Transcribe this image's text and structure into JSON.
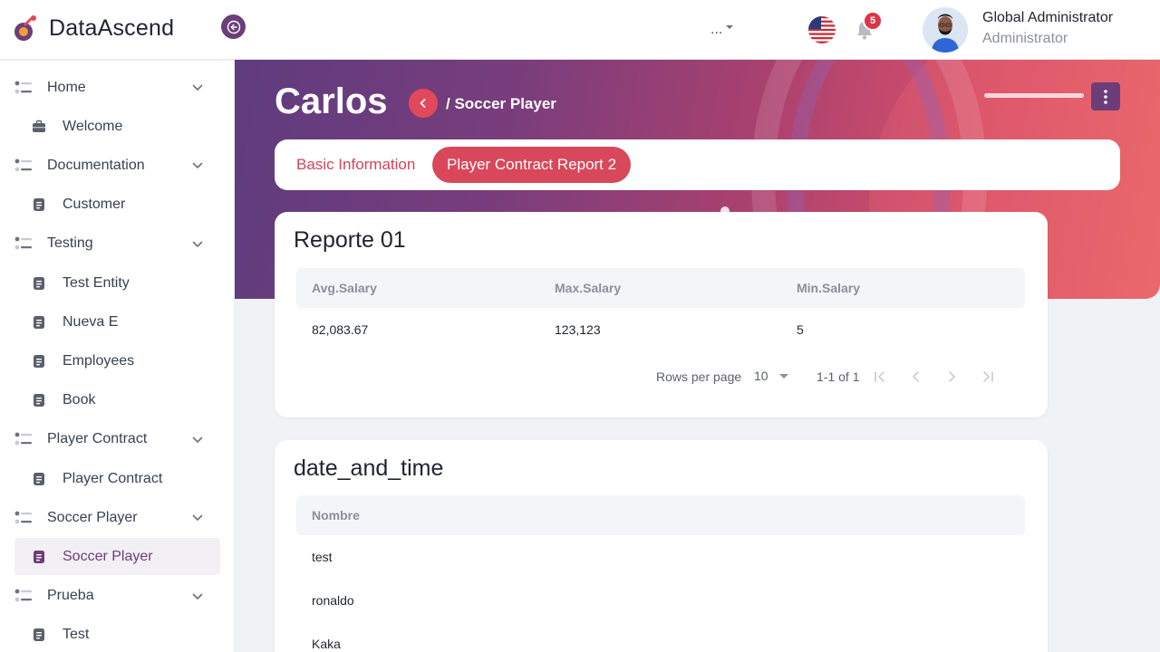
{
  "app": {
    "brand": "DataAscend"
  },
  "topbar": {
    "more_label": "...",
    "notification_count": "5",
    "user_name": "Global Administrator",
    "user_role": "Administrator"
  },
  "sidebar": {
    "items": [
      {
        "type": "group",
        "label": "Home"
      },
      {
        "type": "child",
        "label": "Welcome",
        "icon": "briefcase-icon"
      },
      {
        "type": "group",
        "label": "Documentation"
      },
      {
        "type": "child",
        "label": "Customer",
        "icon": "document-icon"
      },
      {
        "type": "group",
        "label": "Testing"
      },
      {
        "type": "child",
        "label": "Test Entity",
        "icon": "document-icon"
      },
      {
        "type": "child",
        "label": "Nueva E",
        "icon": "document-icon"
      },
      {
        "type": "child",
        "label": "Employees",
        "icon": "document-icon"
      },
      {
        "type": "child",
        "label": "Book",
        "icon": "document-icon"
      },
      {
        "type": "group",
        "label": "Player Contract"
      },
      {
        "type": "child",
        "label": "Player Contract",
        "icon": "document-icon"
      },
      {
        "type": "group",
        "label": "Soccer Player"
      },
      {
        "type": "child",
        "label": "Soccer Player",
        "icon": "document-icon",
        "active": true
      },
      {
        "type": "group",
        "label": "Prueba"
      },
      {
        "type": "child",
        "label": "Test",
        "icon": "document-icon"
      }
    ]
  },
  "page": {
    "title": "Carlos",
    "breadcrumb": "/ Soccer Player"
  },
  "tabs": {
    "basic_info": "Basic Information",
    "contract_report": "Player Contract Report 2"
  },
  "report1": {
    "title": "Reporte 01",
    "columns": [
      "Avg.Salary",
      "Max.Salary",
      "Min.Salary"
    ],
    "rows": [
      [
        "82,083.67",
        "123,123",
        "5"
      ]
    ],
    "pager": {
      "rows_per_page_label": "Rows per page",
      "rows_per_page": "10",
      "range": "1-1 of 1"
    }
  },
  "report2": {
    "title": "date_and_time",
    "columns": [
      "Nombre"
    ],
    "rows": [
      [
        "test"
      ],
      [
        "ronaldo"
      ],
      [
        "Kaka"
      ]
    ]
  },
  "colors": {
    "primary": "#6b3e79",
    "accent": "#d9475a",
    "badge": "#dc3545"
  }
}
